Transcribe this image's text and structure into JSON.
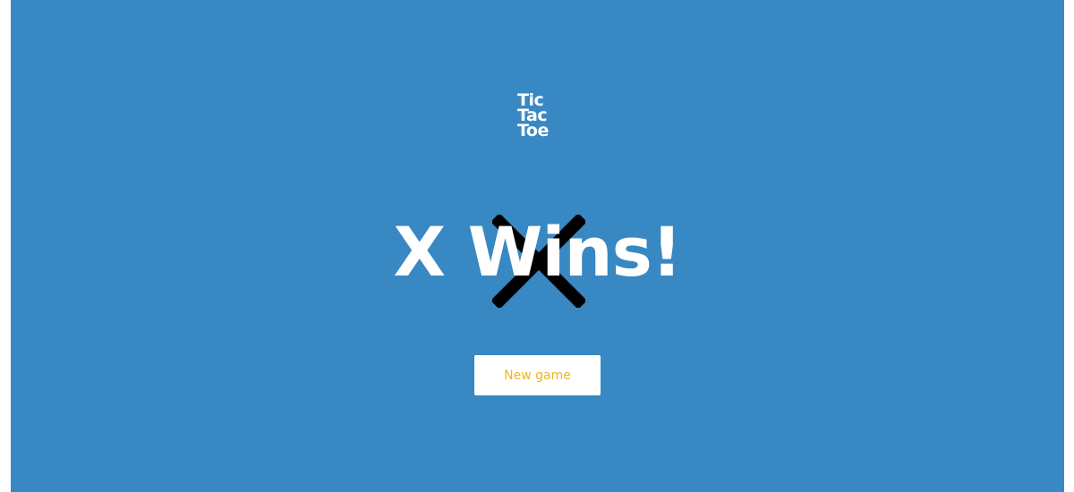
{
  "theme": {
    "background": "#3888c3",
    "foreground": "#ffffff",
    "mark_color": "#000000",
    "button_text_color": "#f2b41e"
  },
  "logo": {
    "lines": [
      "Tic",
      "Tac",
      "Toe"
    ]
  },
  "result": {
    "title": "X Wins!",
    "winner_mark_icon": "x-icon"
  },
  "actions": {
    "new_game_label": "New game"
  }
}
